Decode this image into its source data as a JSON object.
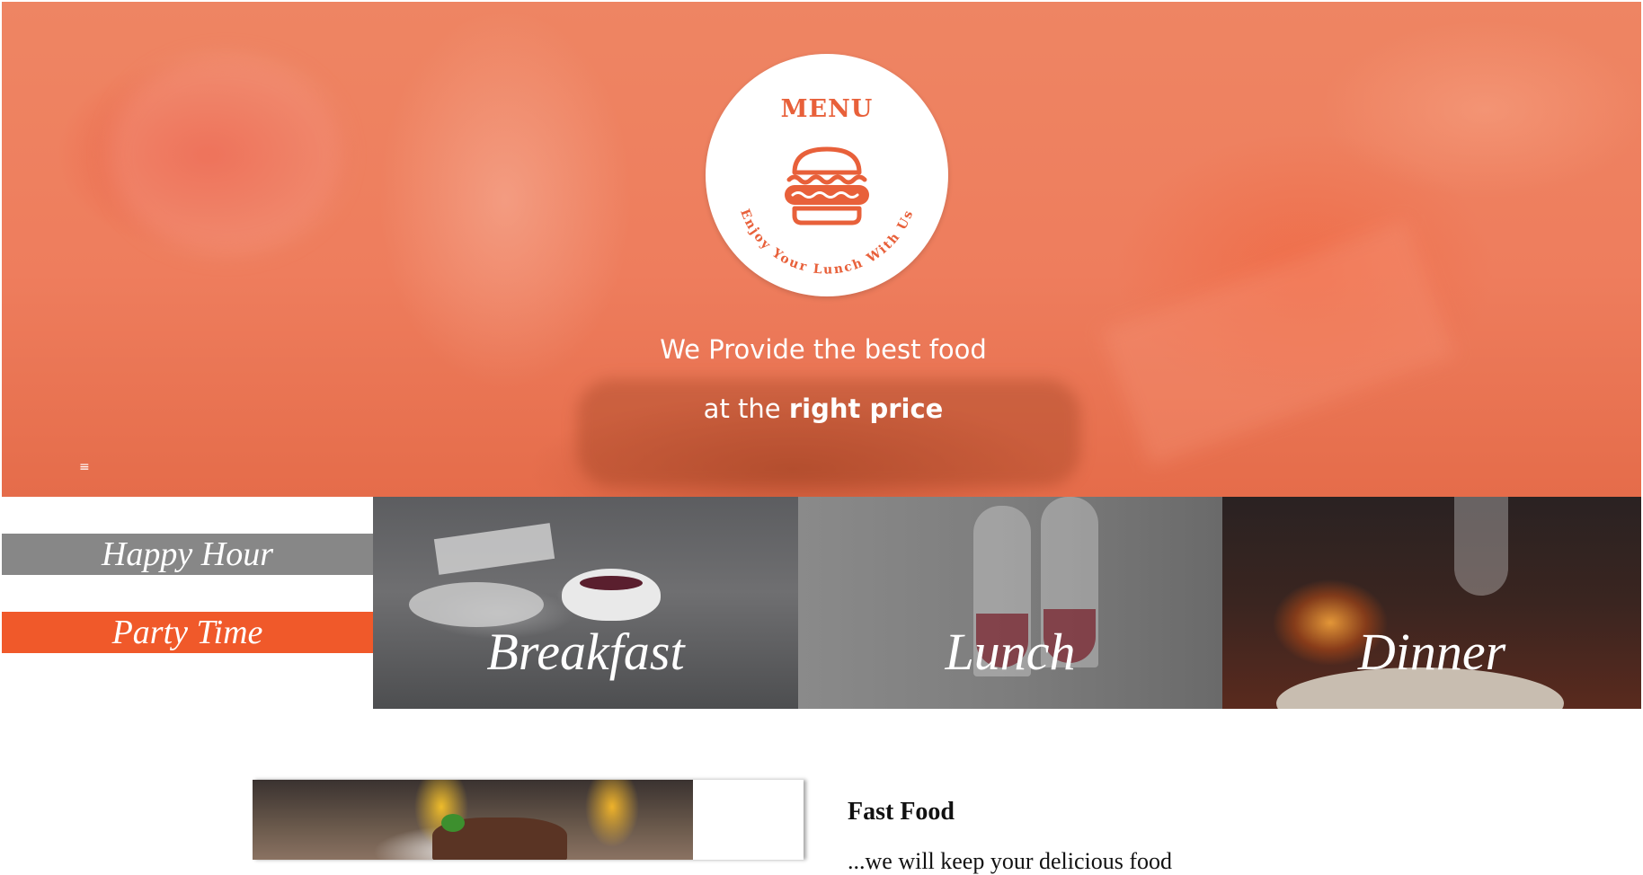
{
  "hero": {
    "logo": {
      "title": "MENU",
      "arc_text": "Enjoy Your Lunch With Us",
      "icon": "burger-icon"
    },
    "tagline_line1": "We Provide the best food",
    "tagline_line2_prefix": "at the ",
    "tagline_line2_bold": "right price",
    "menu_toggle": "≡"
  },
  "side_labels": {
    "happy_hour": "Happy Hour",
    "party_time": "Party Time"
  },
  "meals": [
    {
      "label": "Breakfast"
    },
    {
      "label": "Lunch"
    },
    {
      "label": "Dinner"
    }
  ],
  "feature": {
    "title": "Fast Food",
    "text": "...we will keep your delicious food"
  },
  "colors": {
    "accent": "#f0592a",
    "happy_hour_bg": "#878787",
    "logo_text": "#e8603a"
  }
}
